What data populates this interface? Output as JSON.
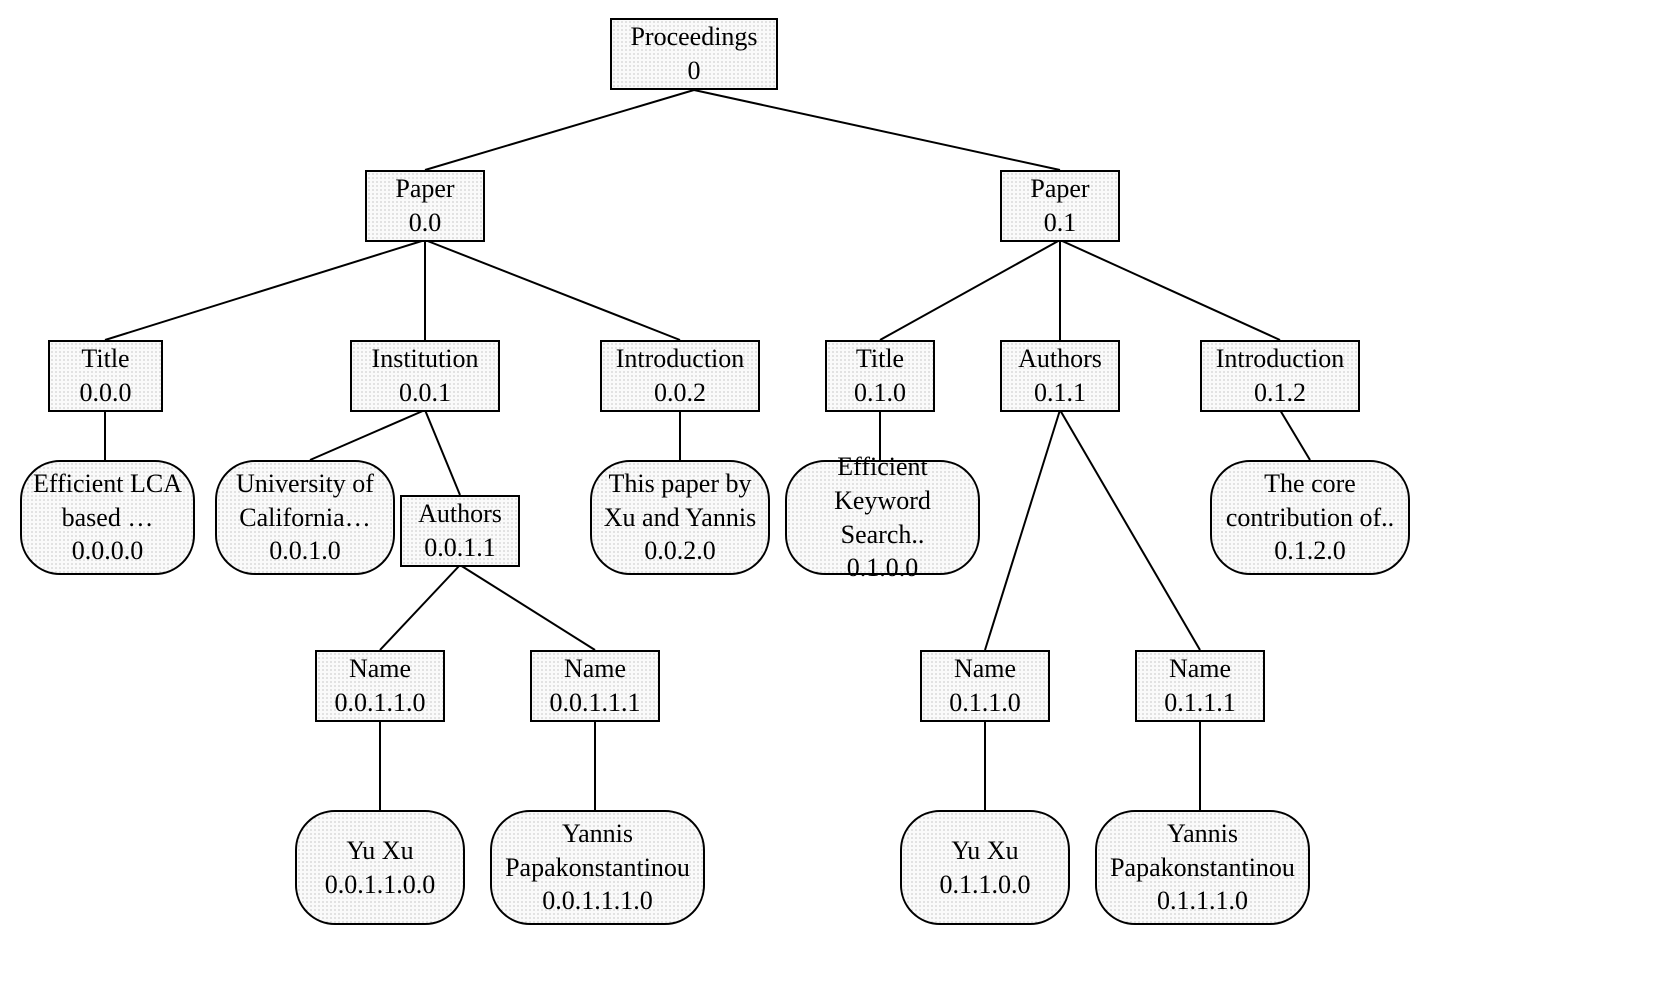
{
  "nodes": {
    "root": {
      "label": "Proceedings",
      "id": "0"
    },
    "paper0": {
      "label": "Paper",
      "id": "0.0"
    },
    "paper1": {
      "label": "Paper",
      "id": "0.1"
    },
    "title0": {
      "label": "Title",
      "id": "0.0.0"
    },
    "institution0": {
      "label": "Institution",
      "id": "0.0.1"
    },
    "introduction0": {
      "label": "Introduction",
      "id": "0.0.2"
    },
    "title1": {
      "label": "Title",
      "id": "0.1.0"
    },
    "authors1": {
      "label": "Authors",
      "id": "0.1.1"
    },
    "introduction1": {
      "label": "Introduction",
      "id": "0.1.2"
    },
    "title0val": {
      "line1": "Efficient LCA",
      "line2": "based …",
      "id": "0.0.0.0"
    },
    "institution0val": {
      "line1": "University of",
      "line2": "California…",
      "id": "0.0.1.0"
    },
    "authors0": {
      "label": "Authors",
      "id": "0.0.1.1"
    },
    "introduction0val": {
      "line1": "This paper by",
      "line2": "Xu and Yannis",
      "id": "0.0.2.0"
    },
    "title1val": {
      "line1": "Efficient",
      "line2": "Keyword Search..",
      "id": "0.1.0.0"
    },
    "introduction1val": {
      "line1": "The core",
      "line2": "contribution of..",
      "id": "0.1.2.0"
    },
    "name00": {
      "label": "Name",
      "id": "0.0.1.1.0"
    },
    "name01": {
      "label": "Name",
      "id": "0.0.1.1.1"
    },
    "name10": {
      "label": "Name",
      "id": "0.1.1.0"
    },
    "name11": {
      "label": "Name",
      "id": "0.1.1.1"
    },
    "name00val": {
      "line1": "Yu Xu",
      "id": "0.0.1.1.0.0"
    },
    "name01val": {
      "line1": "Yannis",
      "line2": "Papakonstantinou",
      "id": "0.0.1.1.1.0"
    },
    "name10val": {
      "line1": "Yu Xu",
      "id": "0.1.1.0.0"
    },
    "name11val": {
      "line1": "Yannis",
      "line2": "Papakonstantinou",
      "id": "0.1.1.1.0"
    }
  }
}
